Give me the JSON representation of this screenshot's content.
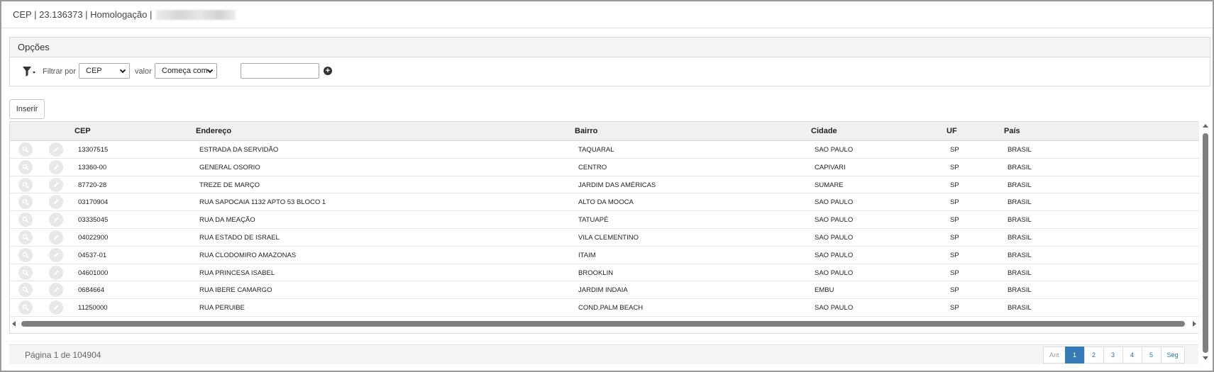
{
  "header": {
    "title": "CEP | 23.136373 | Homologação |"
  },
  "options": {
    "title": "Opções",
    "filter_label": "Filtrar por",
    "filter_field": "CEP",
    "value_label": "valor",
    "operator": "Começa com",
    "value": ""
  },
  "insert_label": "Inserir",
  "columns": [
    "CEP",
    "Endereço",
    "Bairro",
    "Cidade",
    "UF",
    "País"
  ],
  "rows": [
    {
      "cep": "13307515",
      "endereco": "ESTRADA DA SERVIDÃO",
      "bairro": "TAQUARAL",
      "cidade": "SAO PAULO",
      "uf": "SP",
      "pais": "BRASIL"
    },
    {
      "cep": "13360-00",
      "endereco": "GENERAL OSORIO",
      "bairro": "CENTRO",
      "cidade": "CAPIVARI",
      "uf": "SP",
      "pais": "BRASIL"
    },
    {
      "cep": "87720-28",
      "endereco": "TREZE DE MARÇO",
      "bairro": "JARDIM DAS AMÉRICAS",
      "cidade": "SUMARE",
      "uf": "SP",
      "pais": "BRASIL"
    },
    {
      "cep": "03170904",
      "endereco": "RUA SAPOCAIA 1132 APTO 53 BLOCO 1",
      "bairro": "ALTO DA MOOCA",
      "cidade": "SAO PAULO",
      "uf": "SP",
      "pais": "BRASIL"
    },
    {
      "cep": "03335045",
      "endereco": "RUA DA MEAÇÃO",
      "bairro": "TATUAPÉ",
      "cidade": "SAO PAULO",
      "uf": "SP",
      "pais": "BRASIL"
    },
    {
      "cep": "04022900",
      "endereco": "RUA ESTADO DE ISRAEL",
      "bairro": "VILA CLEMENTINO",
      "cidade": "SAO PAULO",
      "uf": "SP",
      "pais": "BRASIL"
    },
    {
      "cep": "04537-01",
      "endereco": "RUA CLODOMIRO AMAZONAS",
      "bairro": "ITAIM",
      "cidade": "SAO PAULO",
      "uf": "SP",
      "pais": "BRASIL"
    },
    {
      "cep": "04601000",
      "endereco": "RUA PRINCESA ISABEL",
      "bairro": "BROOKLIN",
      "cidade": "SAO PAULO",
      "uf": "SP",
      "pais": "BRASIL"
    },
    {
      "cep": "0684664",
      "endereco": "RUA IBERE CAMARGO",
      "bairro": "JARDIM INDAIA",
      "cidade": "EMBU",
      "uf": "SP",
      "pais": "BRASIL"
    },
    {
      "cep": "11250000",
      "endereco": "RUA PERUIBE",
      "bairro": "COND.PALM BEACH",
      "cidade": "SAO PAULO",
      "uf": "SP",
      "pais": "BRASIL"
    }
  ],
  "pagination": {
    "info": "Página 1 de 104904",
    "prev": "Ant",
    "next": "Seg",
    "pages": [
      "1",
      "2",
      "3",
      "4",
      "5"
    ]
  },
  "icons": {
    "view": "magnifier-icon",
    "edit": "pencil-icon",
    "filter": "filter-icon",
    "add": "plus-circle-icon"
  },
  "colors": {
    "active_page": "#337ab7",
    "link": "#2a6fb5"
  }
}
